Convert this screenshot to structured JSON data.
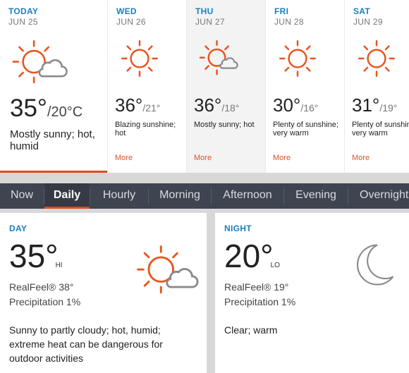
{
  "forecast": [
    {
      "name": "TODAY",
      "date": "JUN 25",
      "hi": "35°",
      "lo": "/20°C",
      "desc": "Mostly sunny; hot, humid",
      "icon": "sun-cloud-icon",
      "more": ""
    },
    {
      "name": "WED",
      "date": "JUN 26",
      "hi": "36°",
      "lo": "/21°",
      "desc": "Blazing sunshine; hot",
      "icon": "sun-icon",
      "more": "More"
    },
    {
      "name": "THU",
      "date": "JUN 27",
      "hi": "36°",
      "lo": "/18°",
      "desc": "Mostly sunny; hot",
      "icon": "sun-cloud-icon",
      "more": "More"
    },
    {
      "name": "FRI",
      "date": "JUN 28",
      "hi": "30°",
      "lo": "/16°",
      "desc": "Plenty of sunshine; very warm",
      "icon": "sun-icon",
      "more": "More"
    },
    {
      "name": "SAT",
      "date": "JUN 29",
      "hi": "31°",
      "lo": "/19°",
      "desc": "Plenty of sunshine; very warm",
      "icon": "sun-icon",
      "more": "More"
    }
  ],
  "tabs": [
    "Now",
    "Daily",
    "Hourly",
    "Morning",
    "Afternoon",
    "Evening",
    "Overnight"
  ],
  "active_tab": "Daily",
  "day_panel": {
    "title": "DAY",
    "temp": "35°",
    "tag": "HI",
    "realfeel": "RealFeel® 38°",
    "precip": "Precipitation 1%",
    "desc": "Sunny to partly cloudy; hot, humid; extreme heat can be dangerous for outdoor activities",
    "icon": "sun-cloud-icon"
  },
  "night_panel": {
    "title": "NIGHT",
    "temp": "20°",
    "tag": "LO",
    "realfeel": "RealFeel® 19°",
    "precip": "Precipitation 1%",
    "desc": "Clear; warm",
    "icon": "moon-icon"
  },
  "colors": {
    "accent": "#e04a1b",
    "label_blue": "#1a7fc1",
    "tab_bar": "#3e4450",
    "sun": "#e8551f",
    "cloud": "#8a8a8a"
  }
}
